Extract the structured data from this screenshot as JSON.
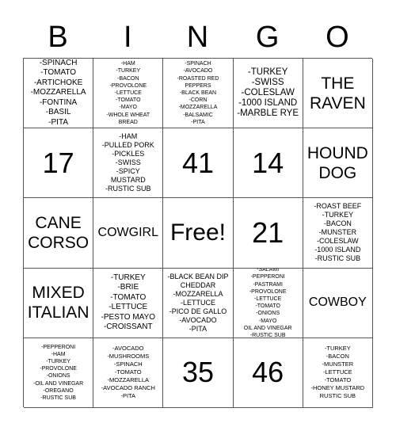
{
  "header": {
    "letters": [
      "B",
      "I",
      "N",
      "G",
      "O"
    ]
  },
  "cells": [
    "-SPINACH\n-TOMATO\n-ARTICHOKE\n-MOZZARELLA\n-FONTINA\n-BASIL\n-PITA",
    "-HAM\n-TURKEY\n-BACON\n-PROVOLONE\n-LETTUCE\n-TOMATO\n-MAYO\n-WHOLE WHEAT\nBREAD",
    "-SPINACH\n-AVOCADO\n-ROASTED RED\nPEPPERS\n-BLACK BEAN\n-CORN\n-MOZZARELLA\n-BALSAMIC\n-PITA",
    "-TURKEY\n-SWISS\n-COLESLAW\n-1000 ISLAND\n-MARBLE RYE",
    "THE\nRAVEN",
    "17",
    "-HAM\n-PULLED PORK\n-PICKLES\n-SWISS\n-SPICY\nMUSTARD\n-RUSTIC SUB",
    "41",
    "14",
    "HOUND\nDOG",
    "CANE\nCORSO",
    "COWGIRL",
    "Free!",
    "21",
    "-ROAST BEEF\n-TURKEY\n-BACON\n-MUNSTER\n-COLESLAW\n-1000 ISLAND\n-RUSTIC SUB",
    "MIXED\nITALIAN",
    "-TURKEY\n-BRIE\n-TOMATO\n-LETTUCE\n-PESTO MAYO\n-CROISSANT",
    "-BLACK BEAN DIP\nCHEDDAR\n-MOZZARELLA\n-LETTUCE\n-PICO DE GALLO\n-AVOCADO\n-PITA",
    "-SALAMI\n-PEPPERONI\n-PASTRAMI\n-PROVOLONE\n-LETTUCE\n-TOMATO\n-ONIONS\n-MAYO\nOIL AND VINEGAR\n-RUSTIC SUB",
    "COWBOY",
    "-PEPPERONI\n-HAM\n-TURKEY\n-PROVOLONE\n-ONIONS\n-OIL AND VINEGAR\n-OREGANO\n-RUSTIC SUB",
    "-AVOCADO\n-MUSHROOMS\n-SPINACH\n-TOMATO\n-MOZZARELLA\n-AVOCADO RANCH\n-PITA",
    "35",
    "46",
    "-TURKEY\n-BACON\n-MUNSTER\n-LETTUCE\n-TOMATO\n-HONEY MUSTARD\nRUSTIC SUB"
  ]
}
